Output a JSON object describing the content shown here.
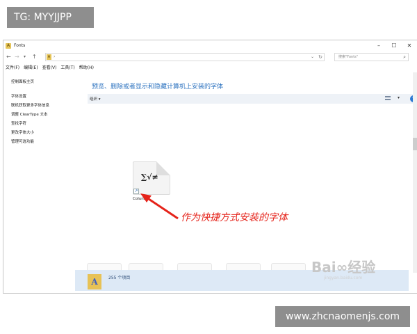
{
  "overlay": {
    "tg_label": "TG: MYYJJPP",
    "site_label": "www.zhcnaomenjs.com"
  },
  "window": {
    "title": "Fonts",
    "icon": "fonts-folder-icon",
    "controls": [
      "minimize",
      "maximize",
      "close"
    ]
  },
  "address": {
    "path_separator": "›",
    "search_placeholder": "搜索\"Fonts\""
  },
  "menu": {
    "items": [
      "文件(F)",
      "编辑(E)",
      "查看(V)",
      "工具(T)",
      "帮助(H)"
    ]
  },
  "nav_pane": {
    "items": [
      "控制面板主页",
      "字体设置",
      "联机获取更多字体信息",
      "调整 ClearType 文本",
      "查找字符",
      "更改字体大小",
      "管理可选功能"
    ]
  },
  "content": {
    "heading": "预览、删除或者显示和隐藏计算机上安装的字体",
    "organize_label": "组织 ▾",
    "view_dropdown": "▾",
    "help_label": "?"
  },
  "file_item": {
    "glyphs": "∑√≠",
    "label": "Coluna"
  },
  "annotation": {
    "text": "作为快捷方式安装的字体",
    "color": "#e5231a"
  },
  "status": {
    "item_count": "255 个项目"
  },
  "watermark": {
    "brand": "Bai∞经验",
    "sub": "jingyan.baidu.com"
  }
}
